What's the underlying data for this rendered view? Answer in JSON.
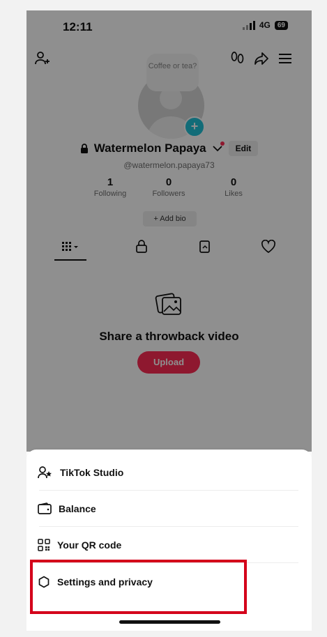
{
  "status_bar": {
    "time": "12:11",
    "network": "4G",
    "battery": "69"
  },
  "profile": {
    "note": "Coffee or tea?",
    "name": "Watermelon Papaya",
    "handle": "@watermelon.papaya73",
    "edit_label": "Edit",
    "stats": [
      {
        "value": "1",
        "label": "Following"
      },
      {
        "value": "0",
        "label": "Followers"
      },
      {
        "value": "0",
        "label": "Likes"
      }
    ],
    "add_bio_label": "+ Add bio"
  },
  "tabs": [
    "videos-grid-icon",
    "lock-icon",
    "reposts-icon",
    "liked-icon"
  ],
  "empty_state": {
    "title": "Share a throwback video",
    "button": "Upload"
  },
  "sheet": {
    "items": [
      {
        "label": "TikTok Studio",
        "icon": "creator-studio-icon"
      },
      {
        "label": "Balance",
        "icon": "wallet-icon"
      },
      {
        "label": "Your QR code",
        "icon": "qr-code-icon"
      },
      {
        "label": "Settings and privacy",
        "icon": "settings-icon"
      }
    ]
  },
  "colors": {
    "accent": "#fe2c55",
    "highlight": "#d4001a",
    "avatar_plus": "#20c0d6"
  }
}
